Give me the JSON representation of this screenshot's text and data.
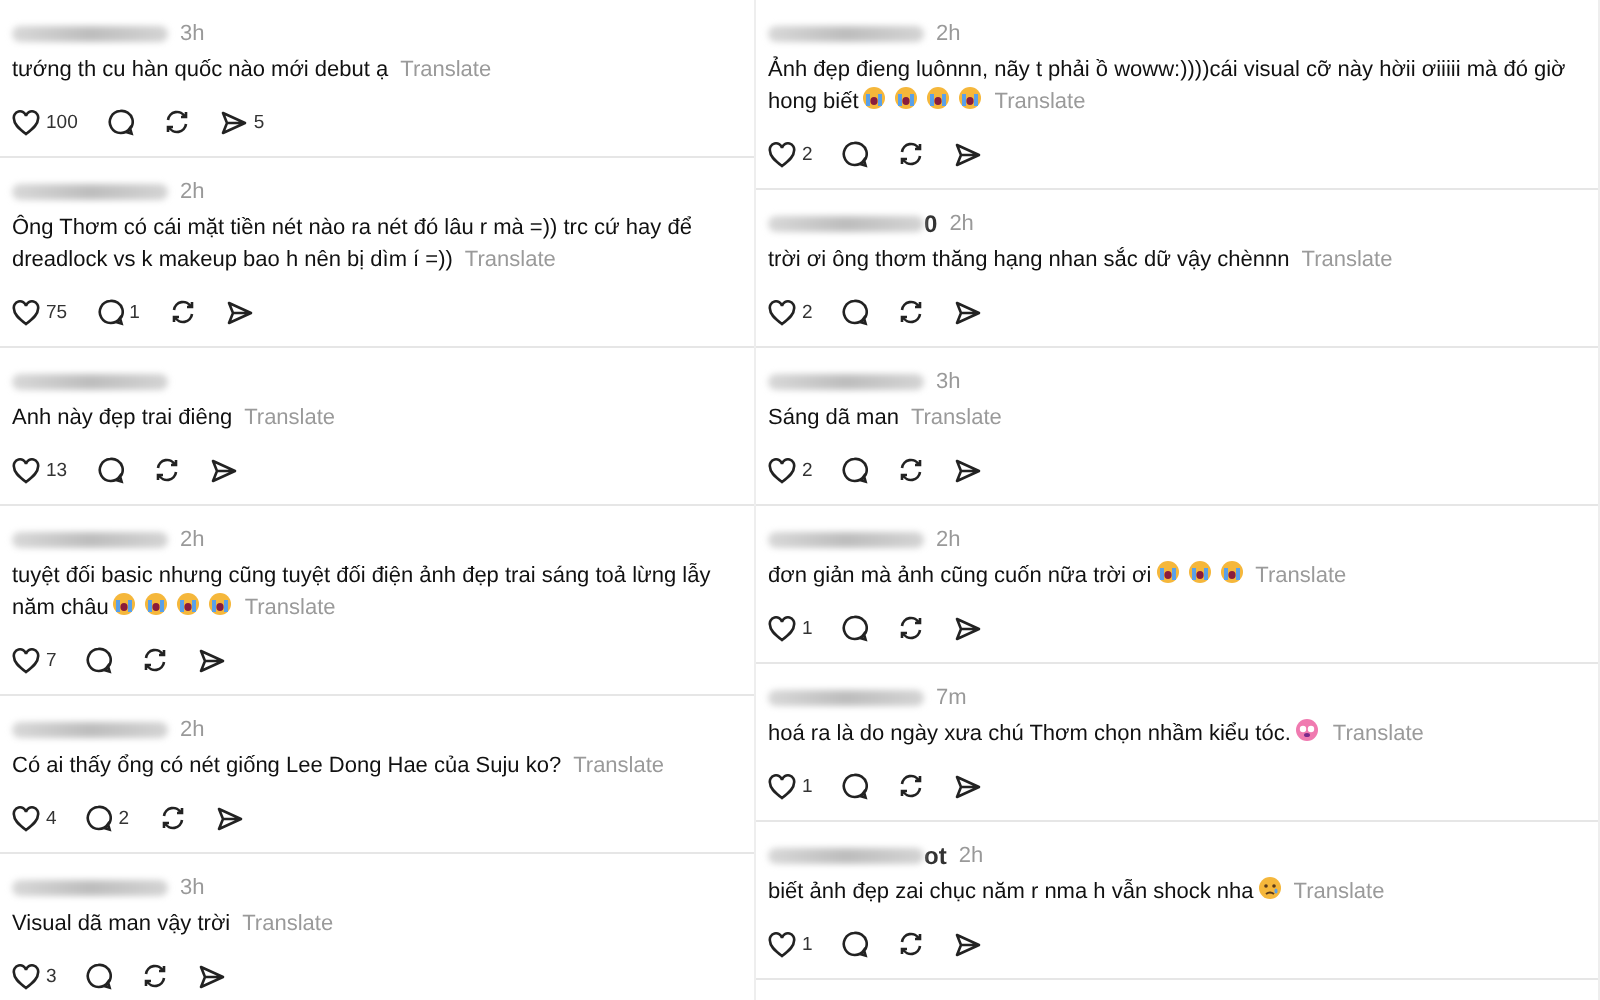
{
  "columns": [
    {
      "comments": [
        {
          "time": "3h",
          "text": "tướng th cu hàn quốc nào mới debut ạ",
          "translate": "Translate",
          "likes": "100",
          "shares": "5"
        },
        {
          "time": "2h",
          "text": "Ông Thơm có cái mặt tiền nét nào ra nét đó lâu r mà =)) trc cứ hay để dreadlock vs k makeup bao h nên bị dìm í =))",
          "translate": "Translate",
          "likes": "75",
          "replies": "1"
        },
        {
          "text": "Anh này đẹp trai điêng",
          "translate": "Translate",
          "likes": "13"
        },
        {
          "time": "2h",
          "text": "tuyệt đối basic nhưng cũng tuyệt đối điện ảnh đẹp trai sáng toả lừng lẫy năm châu",
          "emojis": [
            {
              "kind": "crying"
            },
            {
              "kind": "crying"
            },
            {
              "kind": "crying"
            },
            {
              "kind": "crying"
            }
          ],
          "translate": "Translate",
          "likes": "7"
        },
        {
          "time": "2h",
          "text": "Có ai thấy ổng có nét giống Lee Dong Hae của Suju ko?",
          "translate": "Translate",
          "likes": "4",
          "replies": "2"
        },
        {
          "time": "3h",
          "text": "Visual dã man vậy trời",
          "translate": "Translate",
          "likes": "3"
        }
      ]
    },
    {
      "comments": [
        {
          "time": "2h",
          "text": "Ảnh đẹp đieng luônnn, nãy t phải ồ woww:))))cái visual cỡ này hờii ơiiiii mà đó giờ hong biết",
          "emojis": [
            {
              "kind": "crying"
            },
            {
              "kind": "crying"
            },
            {
              "kind": "crying"
            },
            {
              "kind": "crying"
            }
          ],
          "translate": "Translate",
          "likes": "2"
        },
        {
          "user_tail": "0",
          "time": "2h",
          "text": "trời ơi ông thơm thăng hạng nhan sắc dữ vậy chènnn",
          "translate": "Translate",
          "likes": "2"
        },
        {
          "time": "3h",
          "text": "Sáng dã man",
          "translate": "Translate",
          "likes": "2"
        },
        {
          "time": "2h",
          "text": "đơn giản mà ảnh cũng cuốn nữa trời ơi",
          "emojis": [
            {
              "kind": "crying"
            },
            {
              "kind": "crying"
            },
            {
              "kind": "crying"
            }
          ],
          "translate": "Translate",
          "likes": "1"
        },
        {
          "time": "7m",
          "text": "hoá ra là do ngày xưa chú Thơm chọn nhầm kiểu tóc.",
          "emojis": [
            {
              "kind": "pink"
            }
          ],
          "translate": "Translate",
          "likes": "1"
        },
        {
          "user_tail": "ot",
          "time": "2h",
          "text": "biết ảnh đẹp zai chục năm r nma h vẫn shock nha",
          "emojis": [
            {
              "kind": "teary"
            }
          ],
          "translate": "Translate",
          "likes": "1"
        }
      ]
    }
  ]
}
